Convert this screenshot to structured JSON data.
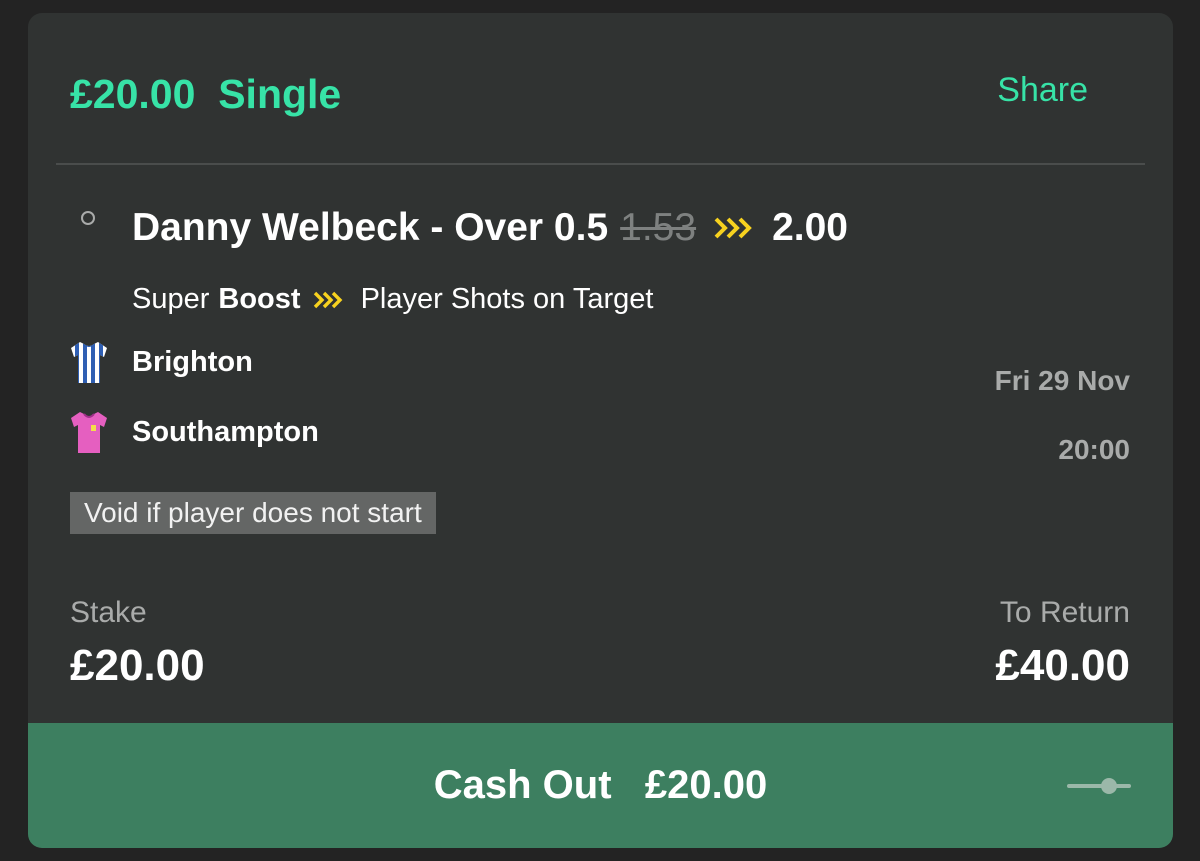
{
  "bet": {
    "stake_display": "£20.00",
    "type": "Single",
    "share_label": "Share"
  },
  "selection": {
    "name": "Danny Welbeck - Over 0.5",
    "old_odds": "1.53",
    "new_odds": "2.00"
  },
  "market": {
    "prefix": "Super",
    "boost": "Boost",
    "name": "Player Shots on Target"
  },
  "event": {
    "home_team": "Brighton",
    "away_team": "Southampton",
    "date": "Fri 29 Nov",
    "time": "20:00"
  },
  "note": "Void if player does not start",
  "totals": {
    "stake_label": "Stake",
    "stake_value": "£20.00",
    "return_label": "To Return",
    "return_value": "£40.00"
  },
  "cashout": {
    "label": "Cash Out",
    "amount": "£20.00"
  },
  "colors": {
    "accent": "#37e3a7",
    "boost": "#f7d21f",
    "cashout_bg": "#3d7f60",
    "card_bg": "#303332"
  },
  "icons": {
    "selection_marker": "radio-circle-icon",
    "boost": "double-chevron-icon",
    "home_kit": "striped-shirt-icon",
    "away_kit": "pink-shirt-icon",
    "cashout_slider": "slider-icon"
  }
}
